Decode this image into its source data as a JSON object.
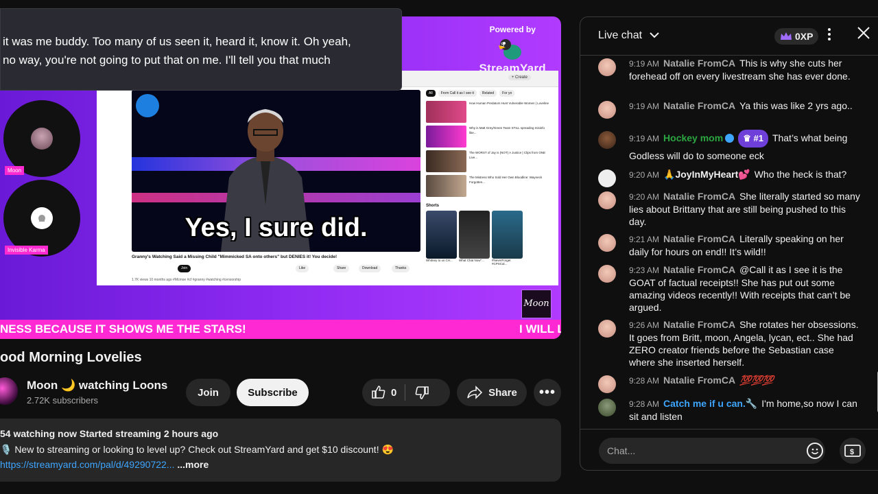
{
  "captions": {
    "line1": "it was me buddy. Too many of us seen it, heard it, know it. Oh yeah,",
    "line2": "no way, you're not going to put that on me. I'll tell you that much"
  },
  "powered": {
    "label": "Powered by",
    "brand": "StreamYard"
  },
  "guests": [
    {
      "name": "Moon"
    },
    {
      "name": "Invisible Karma"
    }
  ],
  "embedded": {
    "subtitle": "Yes, I sure did.",
    "title": "Granny's Watching Said a Missing Child \"Mimmicked SA onto others\" but DENIES it! You decide!",
    "meta": "1.7K views  10 months ago  #Mcmoe #cf #granny #watching #censorship",
    "join": "Join",
    "like": "Like",
    "share": "Share",
    "download": "Download",
    "thanks": "Thanks",
    "create": "+ Create",
    "chips": [
      "All",
      "From Call it as I see it",
      "Related",
      "For yo"
    ],
    "recs": [
      {
        "title": "How Human Predators Hunt Vulnerable Women | Loveline"
      },
      {
        "title": "Why is Matt Grey/Green Team STILL spreading misinfo like..."
      },
      {
        "title": "The WORST of Jay is (NOT) A Justice | Clips from ONE Live..."
      },
      {
        "title": "The Mistress Who Sold Her Own Bloodline: Wayneck Forgotten..."
      }
    ],
    "shorts_label": "Shorts",
    "shorts": [
      "Whitney to us CH...",
      "What Chat Now\"...",
      "#NeverForget #CPSCal..."
    ]
  },
  "ticker": {
    "left": "NESS BECAUSE IT SHOWS ME THE STARS!",
    "right": "I WILL L"
  },
  "signature": "Moon",
  "video": {
    "title": "ood Morning Lovelies",
    "channel": "Moon 🌙 watching Loons",
    "subscribers": "2.72K subscribers",
    "join": "Join",
    "subscribe": "Subscribe",
    "likes": "0",
    "share": "Share"
  },
  "description": {
    "stats": "54 watching now  Started streaming 2 hours ago",
    "promo": "🎙️ New to streaming or looking to level up? Check out StreamYard and get $10 discount! 😍",
    "link": "https://streamyard.com/pal/d/49290722...",
    "more": "...more"
  },
  "chat": {
    "title": "Live chat",
    "xp": "0XP",
    "placeholder": "Chat...",
    "messages": [
      {
        "time": "9:19 AM",
        "author": "Natalie FromCA",
        "text": "This is why she cuts her forehead off on every livestream she has ever done."
      },
      {
        "time": "9:19 AM",
        "author": "Natalie FromCA",
        "text": "Ya this was like 2 yrs ago.."
      },
      {
        "time": "9:19 AM",
        "author": "Hockey mom",
        "rank": "#1",
        "text": "That’s what being Godless will do to someone eck"
      },
      {
        "time": "9:20 AM",
        "author": "🙏JoyInMyHeart💕",
        "text": "Who the heck is that?"
      },
      {
        "time": "9:20 AM",
        "author": "Natalie FromCA",
        "text": "She literally started so many lies about Brittany that are still being pushed to this day."
      },
      {
        "time": "9:21 AM",
        "author": "Natalie FromCA",
        "text": "Literally speaking on her daily for hours on end!! It’s wild!!"
      },
      {
        "time": "9:23 AM",
        "author": "Natalie FromCA",
        "text": "@Call it as I see it is the GOAT of factual receipts!! She has put out some amazing videos recently!! With receipts that can’t be argued."
      },
      {
        "time": "9:26 AM",
        "author": "Natalie FromCA",
        "text": "She rotates her obsessions. It goes from Britt, moon, Angela, lycan, ect.. She had ZERO creator friends before the Sebastian case where she inserted herself."
      },
      {
        "time": "9:28 AM",
        "author": "Natalie FromCA",
        "text": "💯💯💯"
      },
      {
        "time": "9:28 AM",
        "author": "Catch me if u can.🔧",
        "text": "I'm home,so now I can sit and listen"
      }
    ]
  },
  "colors": {
    "accent": "#ff29d4",
    "purple": "#8a28f0",
    "link": "#3ea6ff",
    "moderator": "#2ba640"
  }
}
